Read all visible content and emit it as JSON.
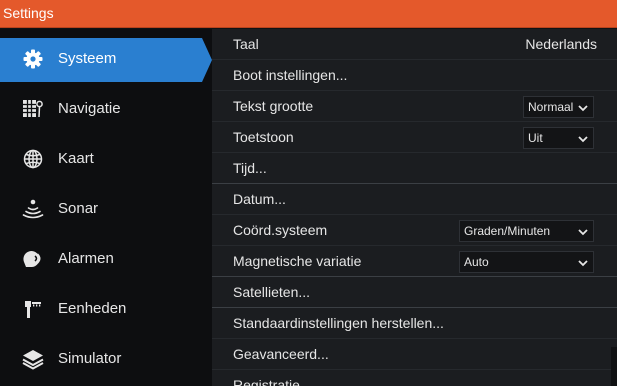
{
  "window": {
    "title": "Settings"
  },
  "sidebar": {
    "items": [
      {
        "label": "Systeem",
        "icon": "gear-icon",
        "active": true
      },
      {
        "label": "Navigatie",
        "icon": "navigation-icon"
      },
      {
        "label": "Kaart",
        "icon": "globe-icon"
      },
      {
        "label": "Sonar",
        "icon": "sonar-icon"
      },
      {
        "label": "Alarmen",
        "icon": "alarm-icon"
      },
      {
        "label": "Eenheden",
        "icon": "units-icon"
      },
      {
        "label": "Simulator",
        "icon": "layers-icon"
      }
    ]
  },
  "settings": {
    "taal": {
      "label": "Taal",
      "value": "Nederlands"
    },
    "boot": {
      "label": "Boot instellingen..."
    },
    "tekst_grootte": {
      "label": "Tekst grootte",
      "value": "Normaal"
    },
    "toetstoon": {
      "label": "Toetstoon",
      "value": "Uit"
    },
    "tijd": {
      "label": "Tijd..."
    },
    "datum": {
      "label": "Datum..."
    },
    "coord": {
      "label": "Coörd.systeem",
      "value": "Graden/Minuten"
    },
    "magnetisch": {
      "label": "Magnetische variatie",
      "value": "Auto"
    },
    "satellieten": {
      "label": "Satellieten..."
    },
    "standaard": {
      "label": "Standaardinstellingen herstellen..."
    },
    "geavanceerd": {
      "label": "Geavanceerd..."
    },
    "registratie": {
      "label": "Registratie..."
    }
  },
  "colors": {
    "titlebar": "#e4592b",
    "active_item": "#2a7fd0",
    "sidebar_bg": "#0d0e10",
    "panel_bg": "#1b1d20"
  }
}
